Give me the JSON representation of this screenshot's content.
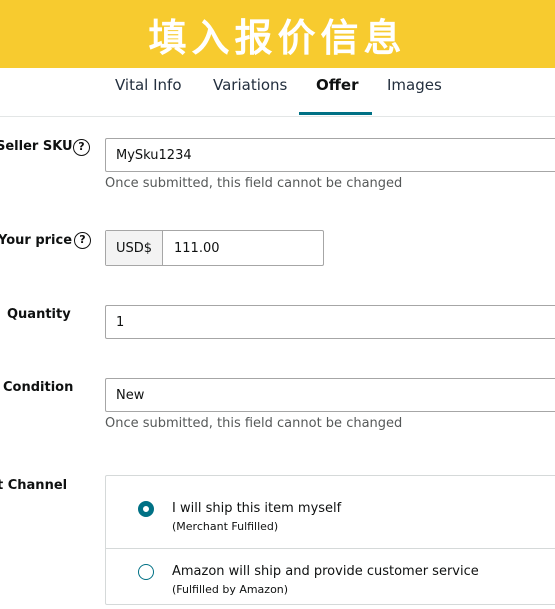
{
  "banner": {
    "title": "填入报价信息"
  },
  "tabs": [
    {
      "label": "Vital Info"
    },
    {
      "label": "Variations"
    },
    {
      "label": "Offer"
    },
    {
      "label": "Images"
    }
  ],
  "active_tab": "Offer",
  "accent_color": "#007185",
  "banner_color": "#f7cb2f",
  "form": {
    "seller_sku": {
      "label": "Seller SKU",
      "help_icon": "?",
      "value": "MySku1234",
      "hint": "Once submitted, this field cannot be changed"
    },
    "your_price": {
      "label": "Your price",
      "help_icon": "?",
      "currency": "USD$",
      "value": "111.00"
    },
    "quantity": {
      "label": "Quantity",
      "value": "1"
    },
    "condition": {
      "label": "Condition",
      "value": "New",
      "hint": "Once submitted, this field cannot be changed"
    },
    "fulfillment": {
      "label": "t Channel",
      "options": [
        {
          "label": "I will ship this item myself",
          "sublabel": "(Merchant Fulfilled)",
          "selected": true
        },
        {
          "label": "Amazon will ship and provide customer service",
          "sublabel": "(Fulfilled by Amazon)",
          "selected": false
        }
      ]
    }
  }
}
